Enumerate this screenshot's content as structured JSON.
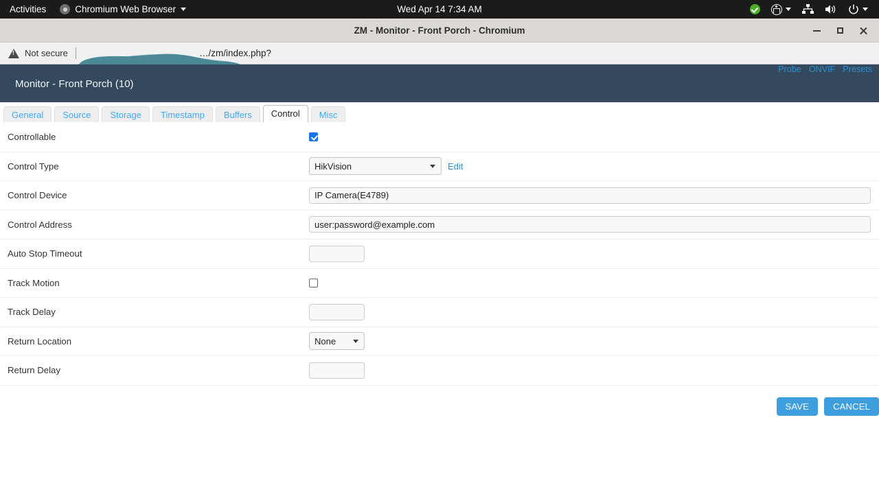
{
  "desktop": {
    "activities_label": "Activities",
    "app_menu_label": "Chromium Web Browser",
    "app_menu_icon": "chromium-icon",
    "clock": "Wed Apr 14  7:34 AM",
    "tray": {
      "status_ok_icon": "green-check-icon",
      "accessibility_icon": "accessibility-icon",
      "network_icon": "network-wired-icon",
      "volume_icon": "volume-speaker-icon",
      "power_icon": "power-icon"
    }
  },
  "window": {
    "title": "ZM - Monitor - Front Porch - Chromium",
    "controls": {
      "minimize": "minimize-icon",
      "maximize": "maximize-icon",
      "close": "close-icon"
    }
  },
  "omnibox": {
    "security_icon": "not-secure-warning-icon",
    "security_label": "Not secure",
    "url_visible_tail": "…/zm/index.php?",
    "redaction_color": "#3f8192"
  },
  "zm": {
    "header_title": "Monitor - Front Porch (10)",
    "header_bg": "#34495e",
    "links": [
      {
        "label": "Probe"
      },
      {
        "label": "ONVIF"
      },
      {
        "label": "Presets"
      }
    ],
    "tabs": [
      {
        "label": "General",
        "active": false
      },
      {
        "label": "Source",
        "active": false
      },
      {
        "label": "Storage",
        "active": false
      },
      {
        "label": "Timestamp",
        "active": false
      },
      {
        "label": "Buffers",
        "active": false
      },
      {
        "label": "Control",
        "active": true
      },
      {
        "label": "Misc",
        "active": false
      }
    ],
    "form": {
      "controllable": {
        "label": "Controllable",
        "checked": true
      },
      "control_type": {
        "label": "Control Type",
        "value": "HikVision",
        "options": [
          "HikVision"
        ],
        "edit_link": "Edit"
      },
      "control_device": {
        "label": "Control Device",
        "value": "IP Camera(E4789)",
        "placeholder": ""
      },
      "control_address": {
        "label": "Control Address",
        "value": "user:password@example.com",
        "placeholder": ""
      },
      "auto_stop_timeout": {
        "label": "Auto Stop Timeout",
        "value": "",
        "placeholder": ""
      },
      "track_motion": {
        "label": "Track Motion",
        "checked": false
      },
      "track_delay": {
        "label": "Track Delay",
        "value": "",
        "placeholder": ""
      },
      "return_location": {
        "label": "Return Location",
        "value": "None",
        "options": [
          "None"
        ]
      },
      "return_delay": {
        "label": "Return Delay",
        "value": "",
        "placeholder": ""
      }
    },
    "buttons": {
      "save": "SAVE",
      "cancel": "CANCEL",
      "accent": "#3e9ede"
    }
  }
}
